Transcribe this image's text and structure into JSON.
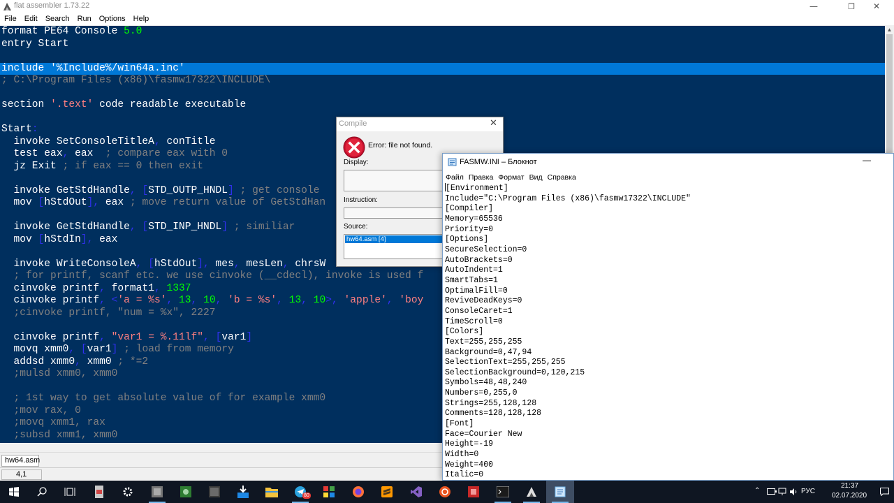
{
  "fasm": {
    "title": "flat assembler 1.73.22",
    "menu": [
      "File",
      "Edit",
      "Search",
      "Run",
      "Options",
      "Help"
    ],
    "tab": "hw64.asm",
    "status_position": "4,1"
  },
  "code_lines": [
    [
      [
        "format PE64 Console ",
        "txt"
      ],
      [
        "5.0",
        "num"
      ]
    ],
    [
      [
        "entry Start",
        "txt"
      ]
    ],
    [],
    [
      [
        "include ",
        "txt"
      ],
      [
        "'%Include%/win64a.inc'",
        "str"
      ]
    ],
    [
      [
        "; C:\\Program Files (x86)\\fasmw17322\\INCLUDE\\",
        "com"
      ]
    ],
    [],
    [
      [
        "section ",
        "txt"
      ],
      [
        "'.text'",
        "str"
      ],
      [
        " code readable executable",
        "txt"
      ]
    ],
    [],
    [
      [
        "Start",
        "txt"
      ],
      [
        ":",
        "sym"
      ]
    ],
    [
      [
        "  invoke SetConsoleTitleA",
        "txt"
      ],
      [
        ",",
        "sym"
      ],
      [
        " conTitle",
        "txt"
      ]
    ],
    [
      [
        "  test eax",
        "txt"
      ],
      [
        ",",
        "sym"
      ],
      [
        " eax  ",
        "txt"
      ],
      [
        "; compare eax with 0",
        "com"
      ]
    ],
    [
      [
        "  jz Exit ",
        "txt"
      ],
      [
        "; if eax == 0 then exit",
        "com"
      ]
    ],
    [],
    [
      [
        "  invoke GetStdHandle",
        "txt"
      ],
      [
        ",",
        "sym"
      ],
      [
        " ",
        "txt"
      ],
      [
        "[",
        "sym"
      ],
      [
        "STD_OUTP_HNDL",
        "txt"
      ],
      [
        "]",
        "sym"
      ],
      [
        " ",
        "txt"
      ],
      [
        "; get console",
        "com"
      ]
    ],
    [
      [
        "  mov ",
        "txt"
      ],
      [
        "[",
        "sym"
      ],
      [
        "hStdOut",
        "txt"
      ],
      [
        "],",
        "sym"
      ],
      [
        " eax ",
        "txt"
      ],
      [
        "; move return value of GetStdHan",
        "com"
      ]
    ],
    [],
    [
      [
        "  invoke GetStdHandle",
        "txt"
      ],
      [
        ",",
        "sym"
      ],
      [
        " ",
        "txt"
      ],
      [
        "[",
        "sym"
      ],
      [
        "STD_INP_HNDL",
        "txt"
      ],
      [
        "]",
        "sym"
      ],
      [
        " ",
        "txt"
      ],
      [
        "; similiar",
        "com"
      ]
    ],
    [
      [
        "  mov ",
        "txt"
      ],
      [
        "[",
        "sym"
      ],
      [
        "hStdIn",
        "txt"
      ],
      [
        "],",
        "sym"
      ],
      [
        " eax",
        "txt"
      ]
    ],
    [],
    [
      [
        "  invoke WriteConsoleA",
        "txt"
      ],
      [
        ",",
        "sym"
      ],
      [
        " ",
        "txt"
      ],
      [
        "[",
        "sym"
      ],
      [
        "hStdOut",
        "txt"
      ],
      [
        "],",
        "sym"
      ],
      [
        " mes",
        "txt"
      ],
      [
        ",",
        "sym"
      ],
      [
        " mesLen",
        "txt"
      ],
      [
        ",",
        "sym"
      ],
      [
        " chrsW",
        "txt"
      ]
    ],
    [
      [
        "  ; for printf, scanf etc. we use cinvoke (__cdecl), invoke is used f",
        "com"
      ]
    ],
    [
      [
        "  cinvoke printf",
        "txt"
      ],
      [
        ",",
        "sym"
      ],
      [
        " format1",
        "txt"
      ],
      [
        ",",
        "sym"
      ],
      [
        " ",
        "txt"
      ],
      [
        "1337",
        "num"
      ]
    ],
    [
      [
        "  cinvoke printf",
        "txt"
      ],
      [
        ",",
        "sym"
      ],
      [
        " ",
        "txt"
      ],
      [
        "<",
        "sym"
      ],
      [
        "'a = %s'",
        "str"
      ],
      [
        ",",
        "sym"
      ],
      [
        " ",
        "txt"
      ],
      [
        "13",
        "num"
      ],
      [
        ",",
        "sym"
      ],
      [
        " ",
        "txt"
      ],
      [
        "10",
        "num"
      ],
      [
        ",",
        "sym"
      ],
      [
        " ",
        "txt"
      ],
      [
        "'b = %s'",
        "str"
      ],
      [
        ",",
        "sym"
      ],
      [
        " ",
        "txt"
      ],
      [
        "13",
        "num"
      ],
      [
        ",",
        "sym"
      ],
      [
        " ",
        "txt"
      ],
      [
        "10",
        "num"
      ],
      [
        ">,",
        "sym"
      ],
      [
        " ",
        "txt"
      ],
      [
        "'apple'",
        "str"
      ],
      [
        ",",
        "sym"
      ],
      [
        " ",
        "txt"
      ],
      [
        "'boy",
        "str"
      ]
    ],
    [
      [
        "  ;cinvoke printf, \"num = %x\", 2227",
        "com"
      ]
    ],
    [],
    [
      [
        "  cinvoke printf",
        "txt"
      ],
      [
        ",",
        "sym"
      ],
      [
        " ",
        "txt"
      ],
      [
        "\"var1 = %.11lf\"",
        "str"
      ],
      [
        ",",
        "sym"
      ],
      [
        " ",
        "txt"
      ],
      [
        "[",
        "sym"
      ],
      [
        "var1",
        "txt"
      ],
      [
        "]",
        "sym"
      ]
    ],
    [
      [
        "  movq xmm0",
        "txt"
      ],
      [
        ",",
        "sym"
      ],
      [
        " ",
        "txt"
      ],
      [
        "[",
        "sym"
      ],
      [
        "var1",
        "txt"
      ],
      [
        "]",
        "sym"
      ],
      [
        " ",
        "txt"
      ],
      [
        "; load from memory",
        "com"
      ]
    ],
    [
      [
        "  addsd xmm0",
        "txt"
      ],
      [
        ",",
        "sym"
      ],
      [
        " xmm0 ",
        "txt"
      ],
      [
        "; *=2",
        "com"
      ]
    ],
    [
      [
        "  ;mulsd xmm0, xmm0",
        "com"
      ]
    ],
    [],
    [
      [
        "  ; 1st way to get absolute value of for example xmm0",
        "com"
      ]
    ],
    [
      [
        "  ;mov rax, 0",
        "com"
      ]
    ],
    [
      [
        "  ;movq xmm1, rax",
        "com"
      ]
    ],
    [
      [
        "  ;subsd xmm1, xmm0",
        "com"
      ]
    ]
  ],
  "compile_dialog": {
    "title": "Compile",
    "close": "✕",
    "error": "Error: file not found.",
    "display_label": "Display:",
    "instruction_label": "Instruction:",
    "source_label": "Source:",
    "source_item": "hw64.asm [4]"
  },
  "notepad": {
    "title": "FASMW.INI – Блокнот",
    "minimize": "—",
    "menu": [
      "Файл",
      "Правка",
      "Формат",
      "Вид",
      "Справка"
    ],
    "lines": [
      "[Environment]",
      "Include=\"C:\\Program Files (x86)\\fasmw17322\\INCLUDE\"",
      "[Compiler]",
      "Memory=65536",
      "Priority=0",
      "[Options]",
      "SecureSelection=0",
      "AutoBrackets=0",
      "AutoIndent=1",
      "SmartTabs=1",
      "OptimalFill=0",
      "ReviveDeadKeys=0",
      "ConsoleCaret=1",
      "TimeScroll=0",
      "[Colors]",
      "Text=255,255,255",
      "Background=0,47,94",
      "SelectionText=255,255,255",
      "SelectionBackground=0,120,215",
      "Symbols=48,48,240",
      "Numbers=0,255,0",
      "Strings=255,128,128",
      "Comments=128,128,128",
      "[Font]",
      "Face=Courier New",
      "Height=-19",
      "Width=0",
      "Weight=400",
      "Italic=0"
    ]
  },
  "taskbar": {
    "language": "РУС",
    "time": "21:37",
    "date": "02.07.2020",
    "badge": "80"
  },
  "colors": {
    "editor_bg": "#002f5e",
    "selection_bg": "#0078d7",
    "numbers": "#00ff00",
    "strings": "#ff8080",
    "comments": "#808080",
    "symbols": "#3030f0"
  }
}
